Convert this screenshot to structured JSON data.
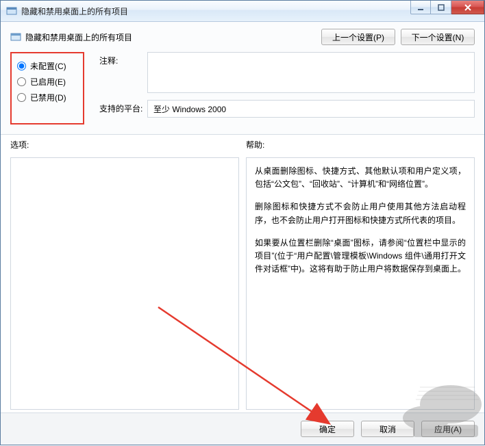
{
  "titlebar": {
    "title": "隐藏和禁用桌面上的所有项目"
  },
  "header": {
    "title": "隐藏和禁用桌面上的所有项目",
    "prev_btn": "上一个设置(P)",
    "next_btn": "下一个设置(N)"
  },
  "radios": {
    "not_configured": "未配置(C)",
    "enabled": "已启用(E)",
    "disabled": "已禁用(D)"
  },
  "fields": {
    "notes_label": "注释:",
    "notes_value": "",
    "platform_label": "支持的平台:",
    "platform_value": "至少 Windows 2000"
  },
  "mid": {
    "options_label": "选项:",
    "help_label": "帮助:",
    "help_paras": [
      "从桌面删除图标、快捷方式、其他默认项和用户定义项，包括“公文包”、“回收站”、“计算机”和“网络位置”。",
      "删除图标和快捷方式不会防止用户使用其他方法启动程序，也不会防止用户打开图标和快捷方式所代表的项目。",
      "如果要从位置栏删除“桌面”图标，请参阅“位置栏中显示的项目”(位于“用户配置\\管理模板\\Windows 组件\\通用打开文件对话框”中)。这将有助于防止用户将数据保存到桌面上。"
    ]
  },
  "footer": {
    "ok": "确定",
    "cancel": "取消",
    "apply": "应用(A)"
  }
}
